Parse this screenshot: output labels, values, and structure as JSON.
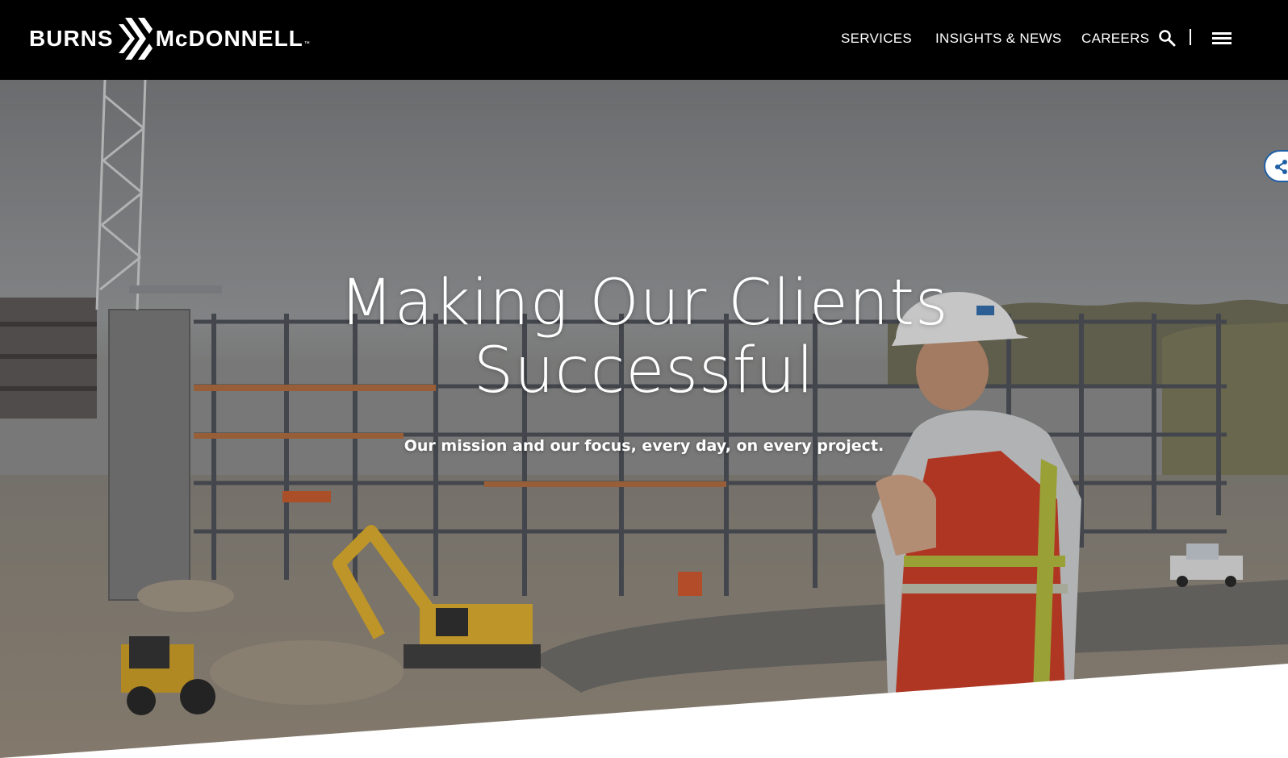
{
  "header": {
    "logo_text_left": "BURNS",
    "logo_text_right": "McDONNELL",
    "logo_tm": "™",
    "nav": {
      "services": "SERVICES",
      "insights": "INSIGHTS & NEWS",
      "careers": "CAREERS"
    },
    "icons": {
      "search": "search-icon",
      "menu": "hamburger-menu-icon",
      "share": "share-icon"
    }
  },
  "hero": {
    "title_line1": "Making Our Clients",
    "title_line2": "Successful",
    "subtitle": "Our mission and our focus, every day, on every project."
  },
  "colors": {
    "header_bg": "#000000",
    "text": "#ffffff",
    "share_border": "#1f5fa6",
    "worker_vest": "#e2321e",
    "excavator": "#e8b428"
  }
}
